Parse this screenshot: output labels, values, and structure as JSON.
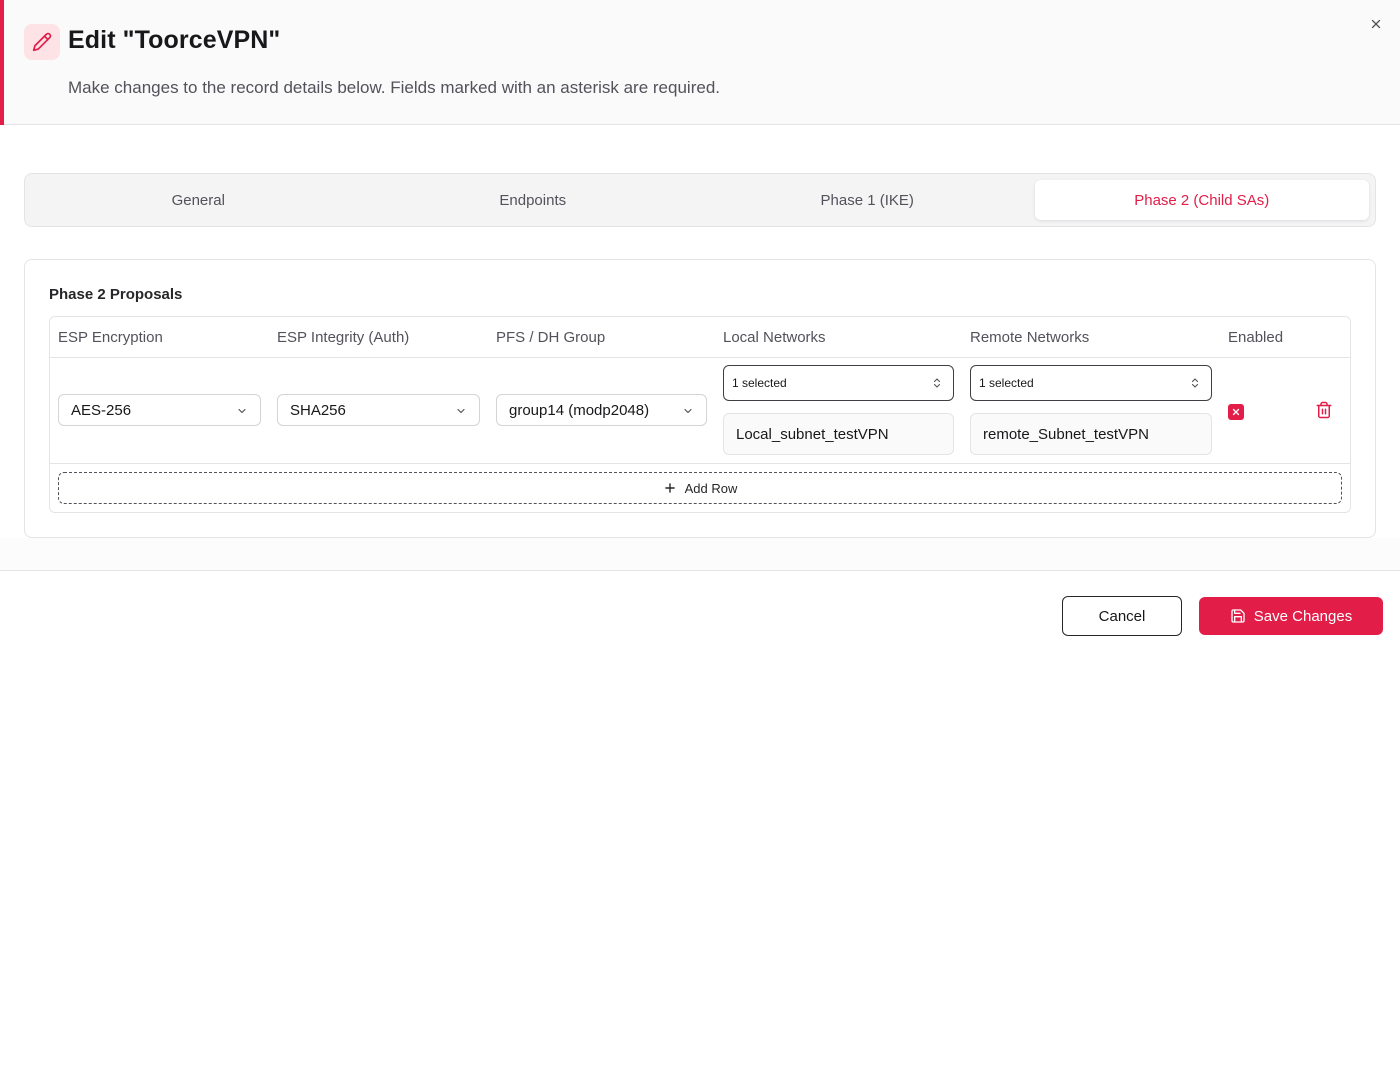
{
  "dialog": {
    "title": "Edit \"ToorceVPN\"",
    "subtitle": "Make changes to the record details below. Fields marked with an asterisk are required.",
    "icon": "pencil-icon",
    "accent_color": "#e11d48"
  },
  "tabs": [
    {
      "label": "General",
      "active": false
    },
    {
      "label": "Endpoints",
      "active": false
    },
    {
      "label": "Phase 1 (IKE)",
      "active": false
    },
    {
      "label": "Phase 2 (Child SAs)",
      "active": true
    }
  ],
  "proposals": {
    "title": "Phase 2 Proposals",
    "columns": [
      "ESP Encryption",
      "ESP Integrity (Auth)",
      "PFS / DH Group",
      "Local Networks",
      "Remote Networks",
      "Enabled"
    ],
    "rows": [
      {
        "esp_encryption": "AES-256",
        "esp_integrity": "SHA256",
        "pfs_dh_group": "group14 (modp2048)",
        "local_networks": {
          "summary": "1 selected",
          "items": [
            "Local_subnet_testVPN"
          ]
        },
        "remote_networks": {
          "summary": "1 selected",
          "items": [
            "remote_Subnet_testVPN"
          ]
        },
        "enabled": true
      }
    ],
    "add_row_label": "Add Row"
  },
  "footer": {
    "cancel_label": "Cancel",
    "save_label": "Save Changes"
  }
}
